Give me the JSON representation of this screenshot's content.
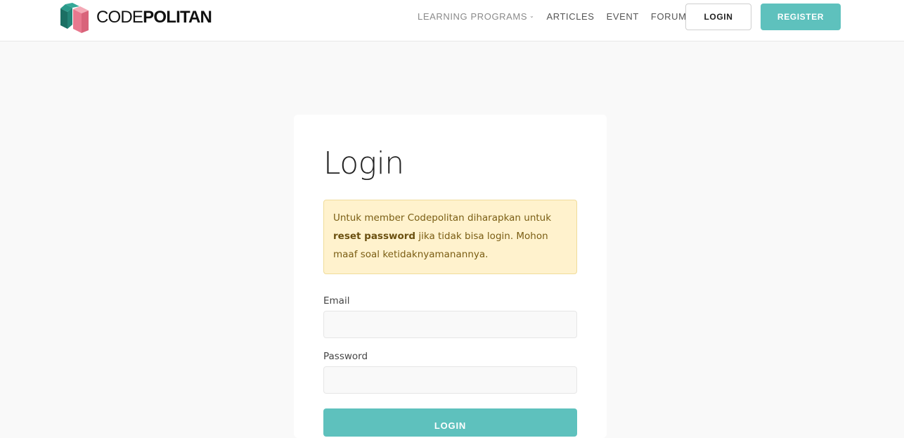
{
  "header": {
    "logo": {
      "icon": "codepolitan-logo-icon",
      "text_thin": "CODE",
      "text_bold": "POLITAN"
    },
    "nav": {
      "learning_programs": "LEARNING PROGRAMS",
      "learning_programs_chevron": "chevron-down-icon",
      "articles": "ARTICLES",
      "event": "EVENT",
      "forum": "FORUM"
    },
    "login_button": "LOGIN",
    "register_button": "REGISTER"
  },
  "login_card": {
    "title": "Login",
    "alert": {
      "text_before": "Untuk member Codepolitan diharapkan untuk ",
      "text_bold": "reset password",
      "text_after": " jika tidak bisa login. Mohon maaf soal ketidaknyamanannya."
    },
    "email_label": "Email",
    "email_value": "",
    "password_label": "Password",
    "password_value": "",
    "submit_button": "LOGIN"
  },
  "colors": {
    "brand_teal": "#5ec1bd",
    "logo_teal_dark": "#1f7d70",
    "logo_pink": "#e8788e",
    "alert_background": "#fff2cd",
    "page_background": "#f9f9f9"
  }
}
